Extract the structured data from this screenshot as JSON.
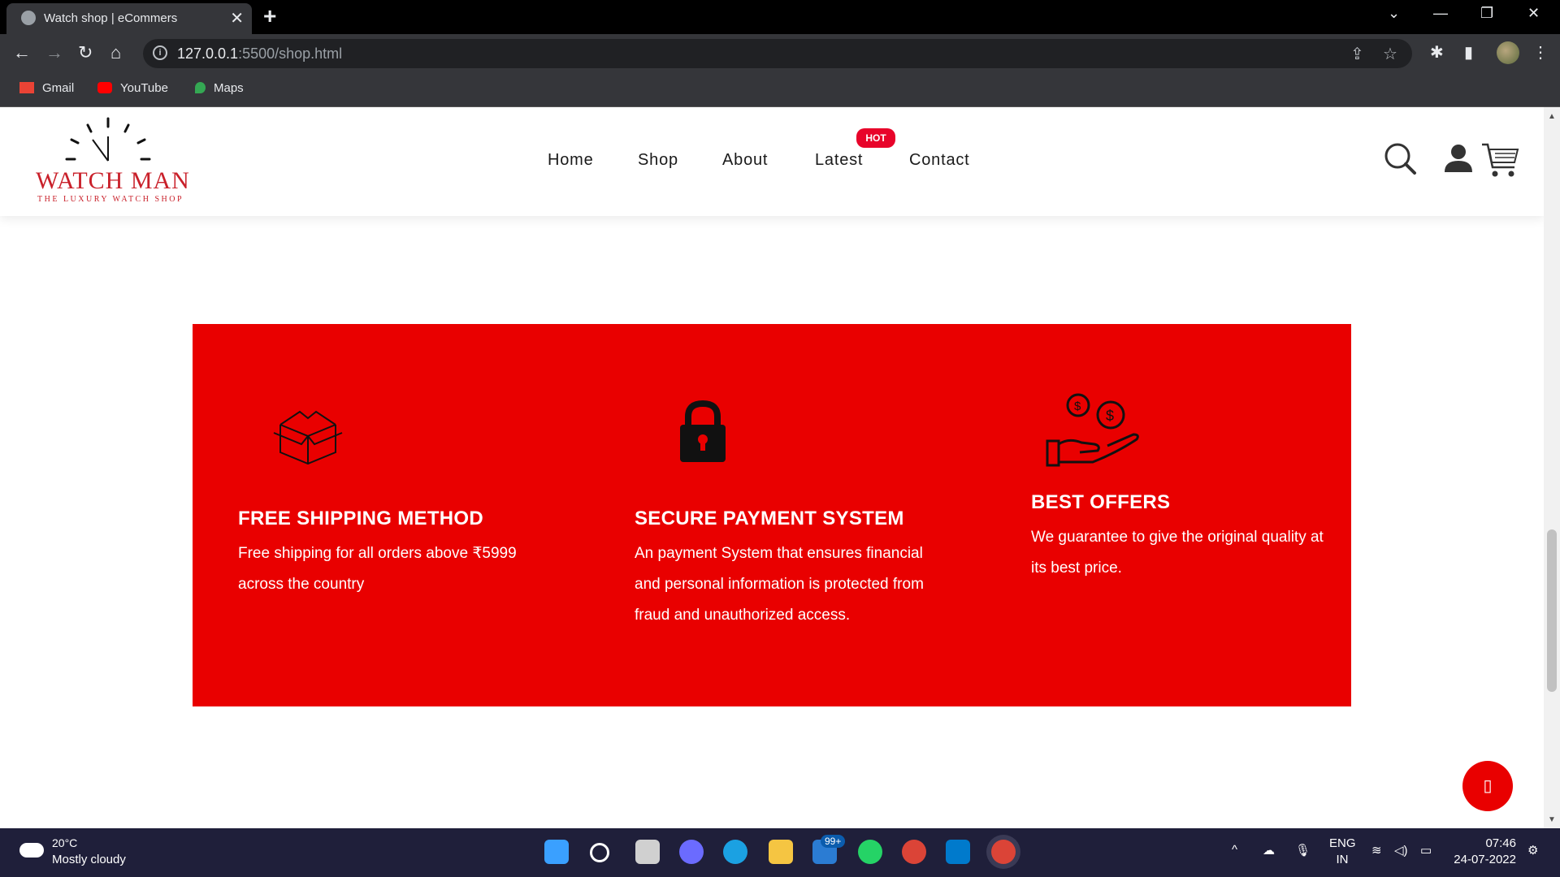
{
  "browser": {
    "tab_title": "Watch shop | eCommers",
    "tab_close": "✕",
    "new_tab": "+",
    "url_host": "127.0.0.1",
    "url_rest": ":5500/shop.html",
    "bookmarks": [
      {
        "label": "Gmail",
        "color": "#ea4335"
      },
      {
        "label": "YouTube",
        "color": "#ff0000"
      },
      {
        "label": "Maps",
        "color": "#34a853"
      }
    ]
  },
  "site": {
    "logo_brand": "WATCH MAN",
    "logo_tagline": "THE LUXURY WATCH SHOP",
    "nav": [
      "Home",
      "Shop",
      "About",
      "Latest",
      "Contact"
    ],
    "hot_badge": "HOT",
    "accent_color": "#e90000"
  },
  "features": [
    {
      "icon": "box-icon",
      "title": "FREE SHIPPING METHOD",
      "text": "Free shipping for all orders above ₹5999 across the country"
    },
    {
      "icon": "lock-icon",
      "title": "SECURE PAYMENT SYSTEM",
      "text": "An payment System that ensures financial and personal information is protected from fraud and unauthorized access."
    },
    {
      "icon": "hand-coins-icon",
      "title": "BEST OFFERS",
      "text": "We guarantee to give the original quality at its best price."
    }
  ],
  "taskbar": {
    "temperature": "20°C",
    "weather": "Mostly cloudy",
    "notification_badge": "99+",
    "lang_top": "ENG",
    "lang_bottom": "IN",
    "time": "07:46",
    "date": "24-07-2022"
  }
}
